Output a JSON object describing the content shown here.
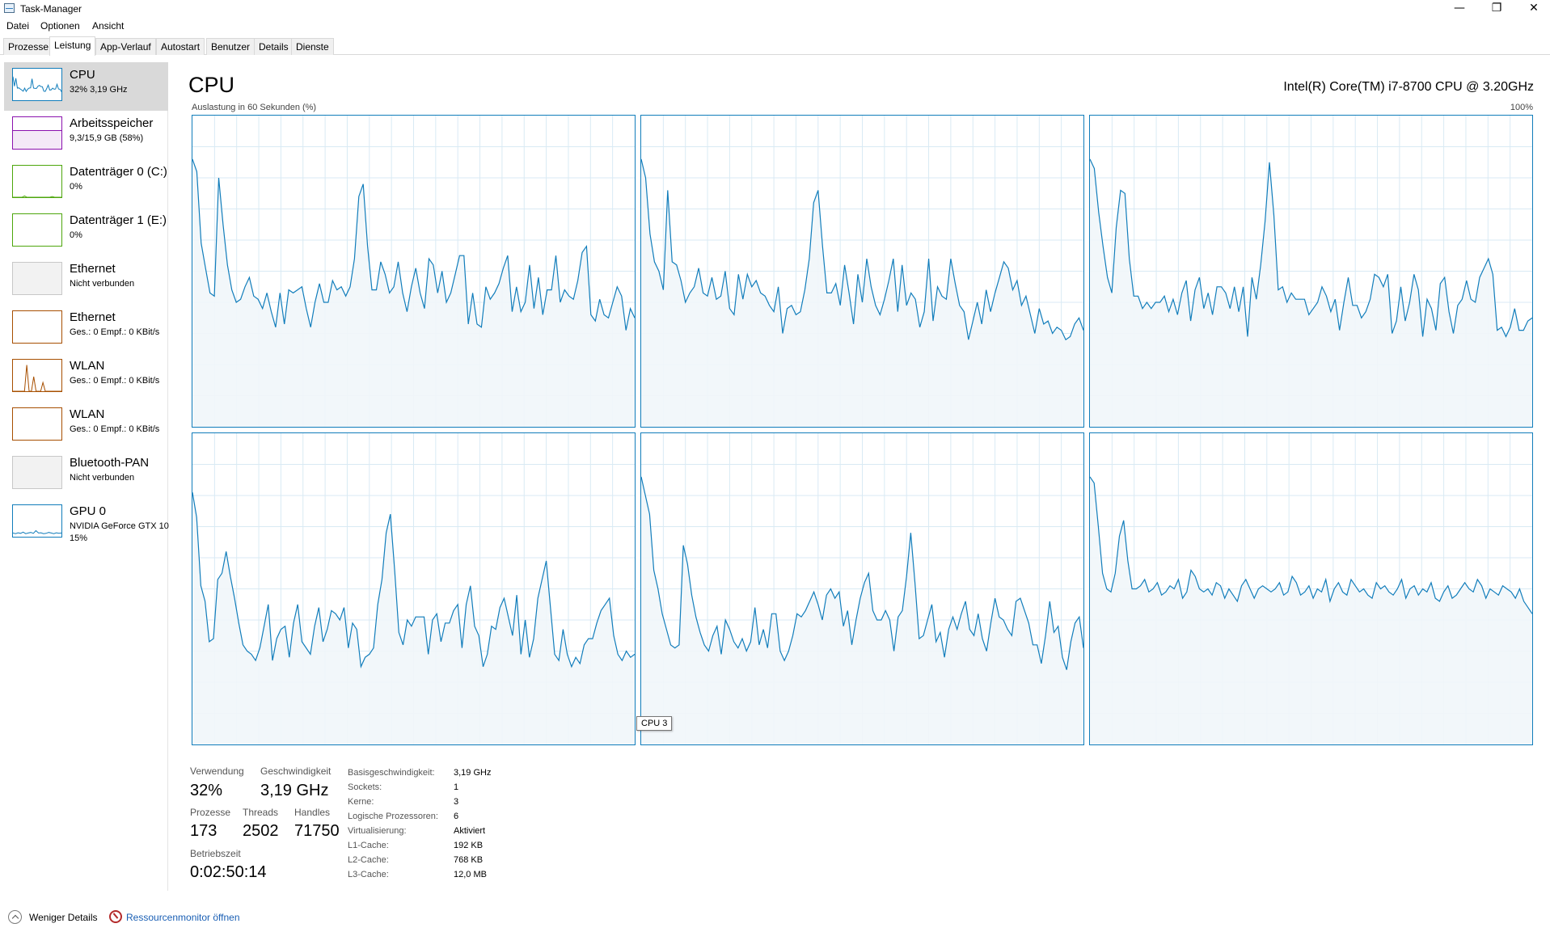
{
  "window": {
    "title": "Task-Manager",
    "minimize": "—",
    "restore": "❐",
    "close": "✕"
  },
  "menu": [
    "Datei",
    "Optionen",
    "Ansicht"
  ],
  "tabs": [
    "Prozesse",
    "Leistung",
    "App-Verlauf",
    "Autostart",
    "Benutzer",
    "Details",
    "Dienste"
  ],
  "active_tab": "Leistung",
  "sidebar": [
    {
      "title": "CPU",
      "sub1": "32%  3,19 GHz",
      "sub2": "",
      "color": "#117dbb",
      "selected": true
    },
    {
      "title": "Arbeitsspeicher",
      "sub1": "9,3/15,9 GB (58%)",
      "sub2": "",
      "color": "#8b12ae"
    },
    {
      "title": "Datenträger 0 (C:)",
      "sub1": "0%",
      "sub2": "",
      "color": "#4da60c"
    },
    {
      "title": "Datenträger 1 (E:)",
      "sub1": "0%",
      "sub2": "",
      "color": "#4da60c"
    },
    {
      "title": "Ethernet",
      "sub1": "Nicht verbunden",
      "sub2": "",
      "color": "#c8c8c8"
    },
    {
      "title": "Ethernet",
      "sub1": "Ges.: 0  Empf.: 0 KBit/s",
      "sub2": "",
      "color": "#a74f01"
    },
    {
      "title": "WLAN",
      "sub1": "Ges.: 0  Empf.: 0 KBit/s",
      "sub2": "",
      "color": "#a74f01"
    },
    {
      "title": "WLAN",
      "sub1": "Ges.: 0  Empf.: 0 KBit/s",
      "sub2": "",
      "color": "#a74f01"
    },
    {
      "title": "Bluetooth-PAN",
      "sub1": "Nicht verbunden",
      "sub2": "",
      "color": "#c8c8c8"
    },
    {
      "title": "GPU 0",
      "sub1": "NVIDIA GeForce GTX 10",
      "sub2": "15%",
      "color": "#117dbb"
    }
  ],
  "main": {
    "title": "CPU",
    "model": "Intel(R) Core(TM) i7-8700 CPU @ 3.20GHz",
    "util_label": "Auslastung in 60 Sekunden (%)",
    "pct_label": "100%",
    "tooltip": "CPU 3"
  },
  "cores": [
    [
      86,
      82,
      59,
      51,
      43,
      42,
      80,
      65,
      52,
      44,
      40,
      41,
      45,
      48,
      42,
      41,
      38,
      43,
      37,
      32,
      43,
      33,
      44,
      43,
      44,
      45,
      38,
      32,
      40,
      46,
      40,
      40,
      47,
      44,
      45,
      42,
      45,
      54,
      74,
      78,
      58,
      44,
      44,
      53,
      49,
      43,
      45,
      53,
      43,
      37,
      45,
      51,
      43,
      38,
      54,
      52,
      43,
      50,
      40,
      43,
      49,
      55,
      55,
      33,
      43,
      33,
      32,
      45,
      41,
      43,
      46,
      51,
      55,
      37,
      45,
      37,
      40,
      52,
      38,
      48,
      36,
      44,
      44,
      55,
      40,
      44,
      42,
      41,
      47,
      56,
      58,
      36,
      34,
      41,
      36,
      35,
      40,
      45,
      42,
      31,
      38,
      35
    ],
    [
      86,
      80,
      62,
      53,
      50,
      44,
      76,
      53,
      52,
      47,
      40,
      43,
      45,
      51,
      43,
      42,
      48,
      41,
      42,
      50,
      38,
      36,
      49,
      41,
      49,
      45,
      47,
      43,
      42,
      39,
      37,
      45,
      30,
      38,
      39,
      36,
      37,
      44,
      54,
      72,
      76,
      58,
      43,
      43,
      46,
      39,
      52,
      43,
      33,
      49,
      40,
      54,
      45,
      39,
      36,
      41,
      47,
      54,
      37,
      52,
      39,
      43,
      41,
      32,
      37,
      54,
      34,
      45,
      42,
      41,
      54,
      46,
      39,
      37,
      28,
      34,
      40,
      33,
      44,
      37,
      43,
      48,
      53,
      51,
      44,
      47,
      39,
      42,
      36,
      30,
      38,
      33,
      34,
      30,
      32,
      31,
      28,
      29,
      33,
      35,
      31
    ],
    [
      86,
      83,
      69,
      58,
      48,
      43,
      64,
      76,
      75,
      54,
      42,
      42,
      38,
      40,
      38,
      40,
      40,
      42,
      37,
      41,
      36,
      43,
      47,
      34,
      44,
      48,
      38,
      43,
      36,
      45,
      45,
      43,
      38,
      45,
      37,
      45,
      29,
      48,
      41,
      52,
      66,
      85,
      68,
      44,
      45,
      40,
      43,
      41,
      41,
      41,
      36,
      38,
      40,
      45,
      42,
      37,
      41,
      31,
      40,
      48,
      39,
      39,
      35,
      37,
      41,
      49,
      48,
      45,
      49,
      30,
      34,
      45,
      34,
      40,
      49,
      44,
      29,
      41,
      38,
      31,
      46,
      48,
      37,
      30,
      39,
      41,
      47,
      41,
      40,
      48,
      51,
      54,
      49,
      31,
      32,
      29,
      32,
      38,
      31,
      31,
      34,
      35
    ],
    [
      81,
      73,
      51,
      46,
      33,
      34,
      53,
      55,
      62,
      54,
      47,
      39,
      32,
      30,
      29,
      27,
      31,
      38,
      45,
      27,
      34,
      37,
      38,
      28,
      39,
      45,
      33,
      31,
      29,
      38,
      44,
      33,
      37,
      43,
      42,
      40,
      44,
      31,
      39,
      37,
      25,
      28,
      29,
      31,
      45,
      53,
      68,
      74,
      56,
      36,
      32,
      40,
      38,
      41,
      41,
      41,
      29,
      40,
      42,
      33,
      39,
      39,
      43,
      45,
      31,
      45,
      51,
      38,
      35,
      25,
      29,
      38,
      37,
      44,
      47,
      41,
      35,
      48,
      29,
      40,
      28,
      34,
      47,
      53,
      59,
      44,
      29,
      27,
      37,
      29,
      25,
      28,
      26,
      32,
      34,
      34,
      39,
      43,
      45,
      47,
      35,
      29,
      27,
      30,
      28,
      29
    ],
    [
      86,
      80,
      74,
      56,
      50,
      42,
      37,
      32,
      31,
      32,
      64,
      58,
      48,
      41,
      36,
      32,
      30,
      35,
      38,
      29,
      40,
      37,
      33,
      31,
      34,
      30,
      33,
      44,
      32,
      37,
      31,
      42,
      42,
      30,
      27,
      30,
      35,
      42,
      41,
      43,
      46,
      49,
      45,
      40,
      48,
      50,
      47,
      49,
      38,
      43,
      32,
      40,
      47,
      52,
      55,
      43,
      40,
      40,
      43,
      40,
      30,
      41,
      43,
      54,
      68,
      52,
      34,
      35,
      40,
      45,
      33,
      36,
      28,
      37,
      41,
      37,
      42,
      46,
      37,
      35,
      42,
      34,
      30,
      39,
      47,
      41,
      40,
      37,
      35,
      46,
      47,
      43,
      39,
      32,
      32,
      26,
      35,
      46,
      36,
      38,
      28,
      24,
      33,
      39,
      41,
      31
    ],
    [
      86,
      84,
      70,
      55,
      50,
      49,
      55,
      67,
      72,
      59,
      50,
      50,
      51,
      53,
      49,
      50,
      52,
      48,
      49,
      51,
      50,
      53,
      47,
      49,
      56,
      54,
      50,
      49,
      50,
      48,
      52,
      51,
      47,
      50,
      48,
      46,
      51,
      53,
      50,
      47,
      50,
      51,
      50,
      49,
      50,
      52,
      48,
      49,
      54,
      52,
      48,
      49,
      51,
      47,
      50,
      49,
      53,
      46,
      50,
      52,
      49,
      48,
      53,
      51,
      49,
      50,
      48,
      47,
      52,
      50,
      51,
      49,
      48,
      50,
      53,
      47,
      50,
      51,
      48,
      50,
      49,
      52,
      47,
      46,
      49,
      51,
      47,
      48,
      50,
      52,
      50,
      49,
      53,
      51,
      47,
      50,
      49,
      48,
      51,
      50,
      49,
      47,
      50,
      46,
      44,
      42
    ]
  ],
  "stats": {
    "usage_label": "Verwendung",
    "usage": "32%",
    "speed_label": "Geschwindigkeit",
    "speed": "3,19 GHz",
    "proc_label": "Prozesse",
    "proc": "173",
    "threads_label": "Threads",
    "threads": "2502",
    "handles_label": "Handles",
    "handles": "71750",
    "uptime_label": "Betriebszeit",
    "uptime": "0:02:50:14"
  },
  "info": [
    {
      "label": "Basisgeschwindigkeit:",
      "value": "3,19 GHz"
    },
    {
      "label": "Sockets:",
      "value": "1"
    },
    {
      "label": "Kerne:",
      "value": "3"
    },
    {
      "label": "Logische Prozessoren:",
      "value": "6"
    },
    {
      "label": "Virtualisierung:",
      "value": "Aktiviert"
    },
    {
      "label": "L1-Cache:",
      "value": "192 KB"
    },
    {
      "label": "L2-Cache:",
      "value": "768 KB"
    },
    {
      "label": "L3-Cache:",
      "value": "12,0 MB"
    }
  ],
  "footer": {
    "less_details": "Weniger Details",
    "resmon": "Ressourcenmonitor öffnen"
  }
}
